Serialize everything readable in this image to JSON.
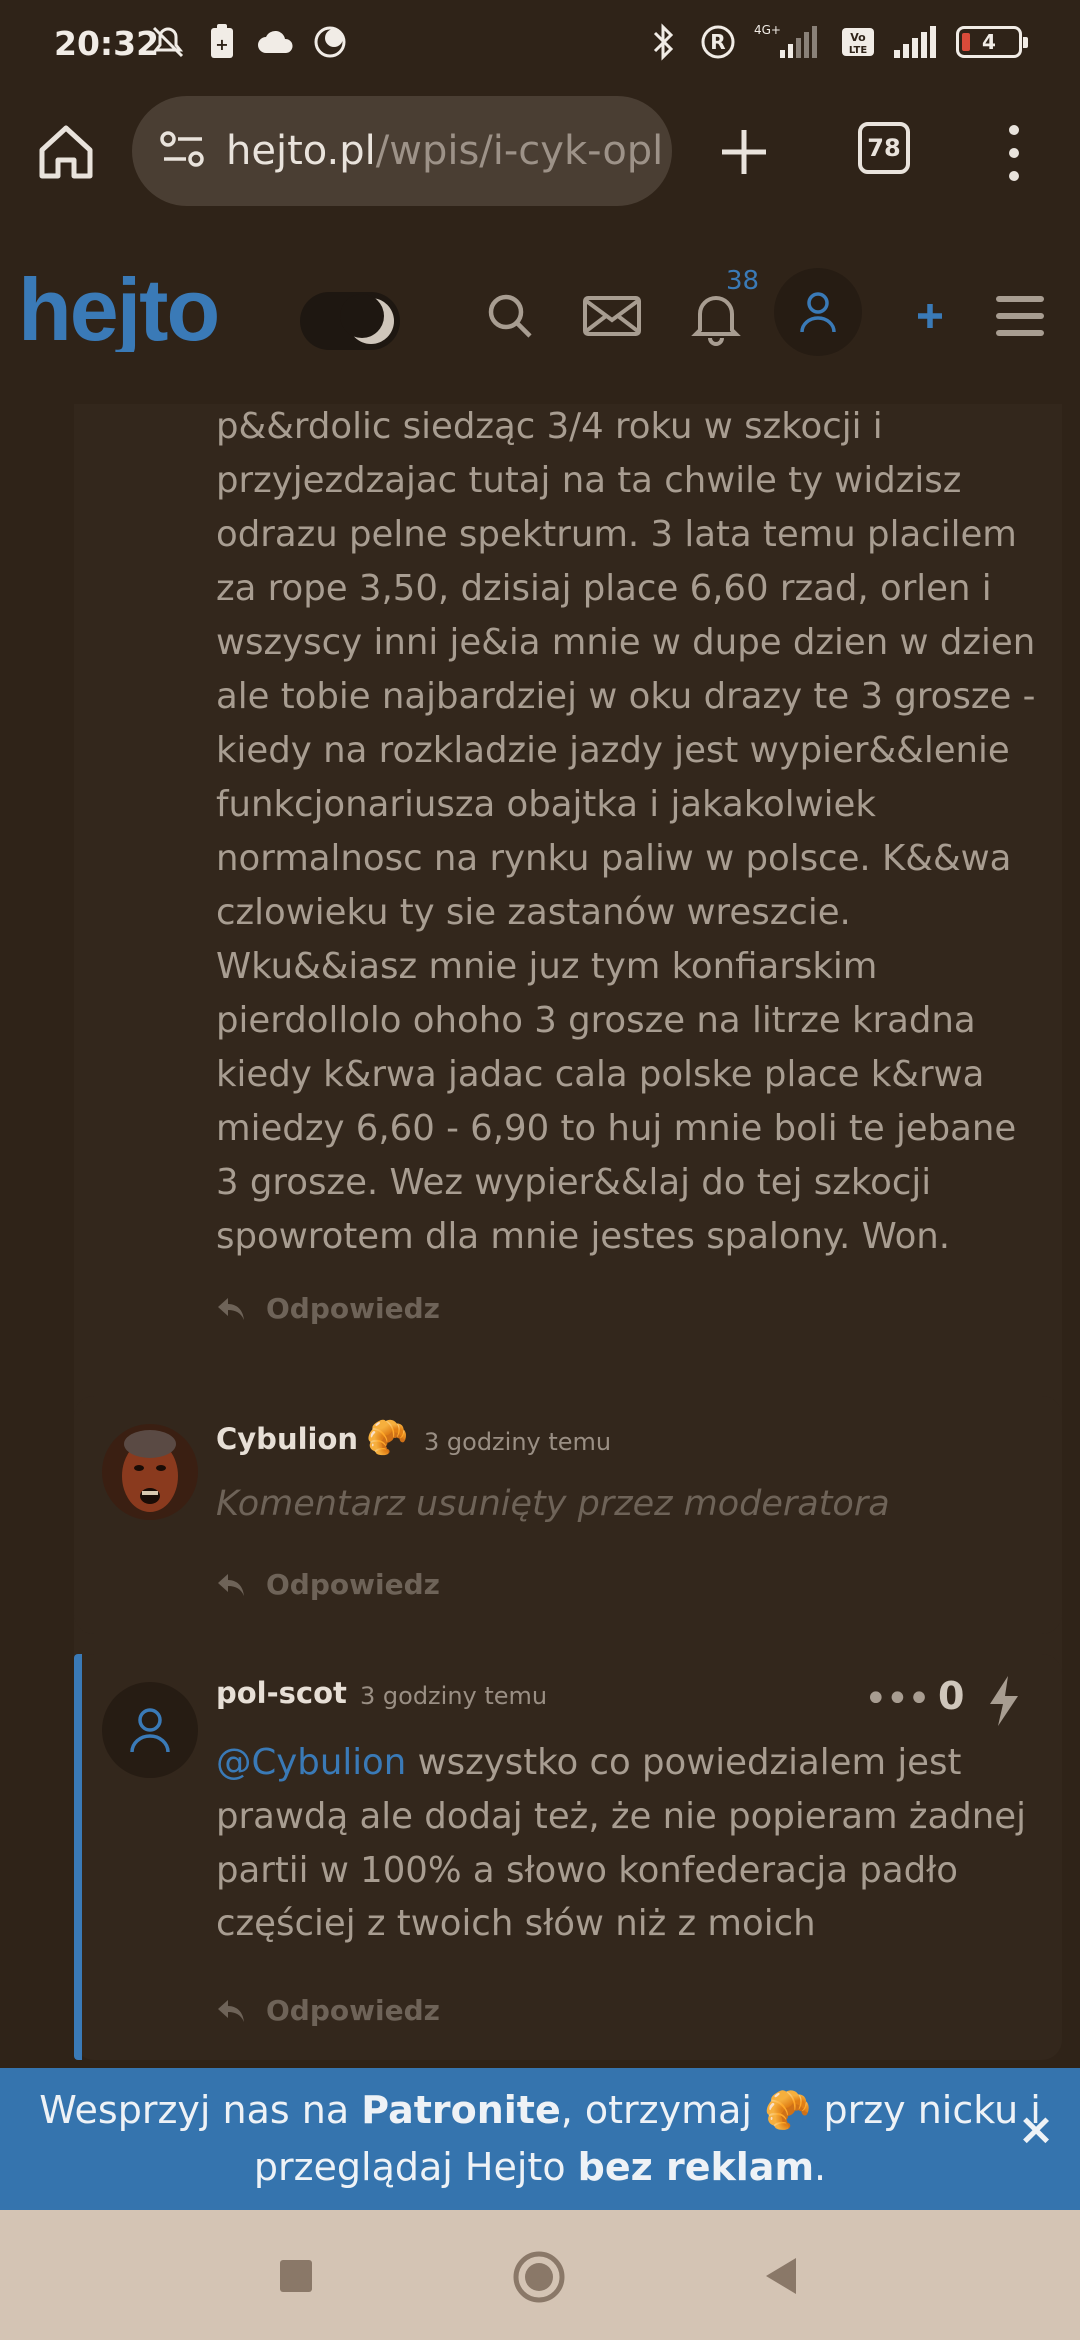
{
  "status_bar": {
    "time": "20:32",
    "network_label": "4G+",
    "volte_label": "Vo LTE",
    "battery": "4"
  },
  "browser": {
    "url_domain": "hejto.pl",
    "url_path": "/wpis/i-cyk-opl",
    "tab_count": "78"
  },
  "site": {
    "logo_text": "hejto",
    "notification_count": "38"
  },
  "comments": [
    {
      "text_lines": [
        "p&&rdolic siedząc 3/4 roku w szkocji i",
        "przyjezdzajac tutaj na ta chwile ty widzisz",
        "odrazu pelne spektrum. 3 lata temu placilem",
        "za rope 3,50, dzisiaj place 6,60 rzad, orlen i",
        "wszyscy inni je&ia mnie w dupe dzien w dzien",
        "ale tobie najbardziej w oku drazy te 3 grosze -",
        "kiedy na rozkladzie jazdy jest wypier&&lenie",
        "funkcjonariusza obajtka i jakakolwiek",
        "normalnosc na rynku paliw w polsce. K&&wa",
        "czlowieku ty sie zastanów wreszcie.",
        "Wku&&iasz mnie juz tym konfiarskim",
        "pierdollolo ohoho 3 grosze na litrze kradna",
        "kiedy k&rwa jadac cala polske place k&rwa",
        "miedzy 6,60 - 6,90 to huj mnie boli te jebane",
        "3 grosze. Wez wypier&&laj do tej szkocji",
        "spowrotem dla mnie jestes spalony. Won."
      ],
      "reply_label": "Odpowiedz"
    },
    {
      "author": "Cybulion",
      "badge": "🥐",
      "time": "3 godziny temu",
      "text": "Komentarz usunięty przez moderatora",
      "reply_label": "Odpowiedz"
    },
    {
      "author": "pol-scot",
      "time": "3 godziny temu",
      "mention": "@Cybulion",
      "text_first": " wszystko co powiedzialem jest",
      "text_lines": [
        "prawdą ale dodaj też, że nie popieram żadnej",
        "partii w 100% a słowo konfederacja padło",
        "częściej z twoich słów niż z moich"
      ],
      "votes": "0",
      "more": "•••",
      "reply_label": "Odpowiedz"
    }
  ],
  "banner": {
    "part1": "Wesprzyj nas na ",
    "patronite": "Patronite",
    "part2": ", otrzymaj ",
    "emoji": "🥐",
    "part3": " przy nicku i",
    "part4": "przeglądaj Hejto ",
    "no_ads": "bez reklam",
    "part5": ".",
    "close": "×"
  },
  "colors": {
    "background": "#2f2318",
    "card": "#33271c",
    "accent_blue": "#3a7ab7",
    "banner": "#3574ae",
    "nav_bar": "#d4c4b4"
  }
}
